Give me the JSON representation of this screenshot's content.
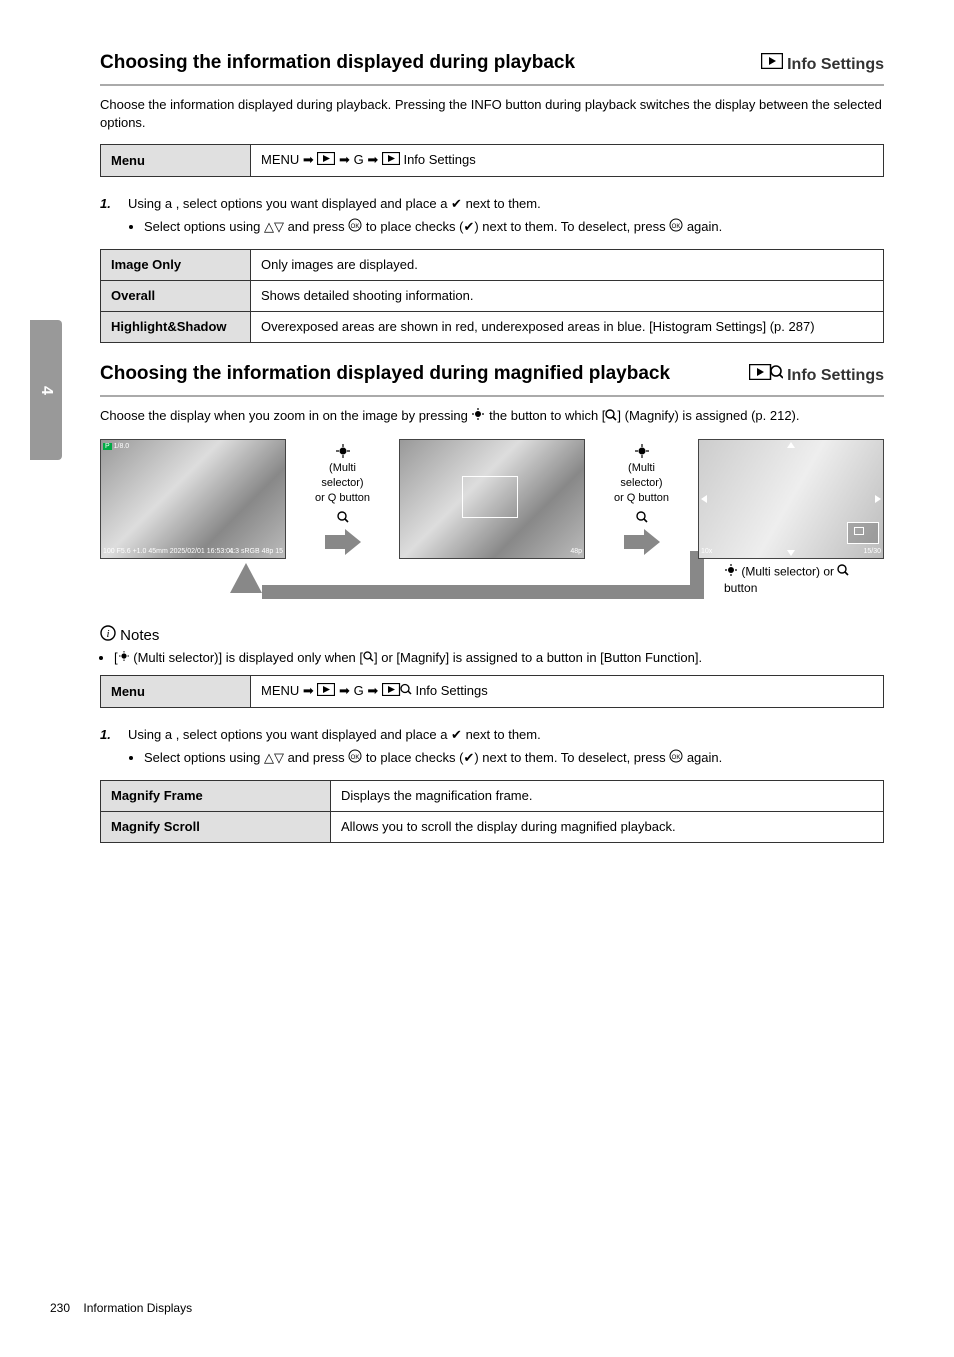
{
  "sideTab": "4",
  "section1": {
    "heading": "Choosing the information displayed during playback",
    "subtitleIcon": "play-box-icon",
    "subtitle": "Info Settings",
    "para": "Choose the information displayed during playback. Pressing the INFO button during playback switches the display between the selected options."
  },
  "nav1": {
    "label": "Menu",
    "path1": "MENU",
    "path2": "G",
    "path3": "Info Settings"
  },
  "selection1": {
    "step": "1.",
    "text": "Using a , select options you want displayed and place a ✔ next to them.",
    "detail": "Select options using △▽ and press OK to place checks (✔) next to them. To deselect, press OK again."
  },
  "options1": [
    {
      "label": "Image Only",
      "desc": "Only images are displayed."
    },
    {
      "label": "Overall",
      "desc": "Shows detailed shooting information."
    },
    {
      "label": "Highlight&Shadow",
      "desc": "Overexposed areas are shown in red, underexposed areas in blue. [Histogram Settings] (p. 287)"
    }
  ],
  "section2": {
    "heading": "Choosing the information displayed during magnified playback",
    "subtitleIcon": "play-zoom-icon",
    "subtitle": "Info Settings",
    "para": "Choose the display when you zoom in on the image by pressing the button to which [Q] (Magnify) is assigned (p. 212)."
  },
  "arrowLabels": {
    "label1a": "(Multi selector)",
    "label1b": "or Q button",
    "label2a": "(Multi selector)",
    "label2b": "or Q button"
  },
  "shot1": {
    "tl": "",
    "tr": "",
    "bl": "100 F5.6 +1.0 45mm\n2025/02/01 16:53:01",
    "br": "4:3 sRGB\n48p 15"
  },
  "shot2": {
    "br": "48p"
  },
  "shot3": {
    "bl": "10x",
    "br": "15/30"
  },
  "returnL": "(Multi selector) or Q button",
  "notes": {
    "title": "Notes",
    "items": [
      "[ (Multi selector)] is displayed only when [Q] or [Magnify] is assigned to a button in [Button Function]."
    ]
  },
  "nav2": {
    "label": "Menu",
    "path1": "MENU",
    "path2": "G",
    "path3": "Info Settings"
  },
  "selection2": {
    "step": "1.",
    "text": "Using a , select options you want displayed and place a ✔ next to them.",
    "detail": "Select options using △▽ and press OK to place checks (✔) next to them. To deselect, press OK again."
  },
  "options2": [
    {
      "label": "Magnify Frame",
      "desc": "Displays the magnification frame."
    },
    {
      "label": "Magnify Scroll",
      "desc": "Allows you to scroll the display during magnified playback."
    }
  ],
  "footer": {
    "page": "230",
    "section": "Information Displays"
  }
}
